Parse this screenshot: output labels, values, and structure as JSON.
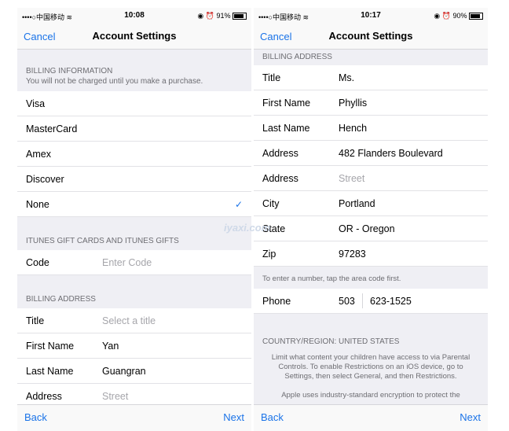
{
  "left": {
    "status": {
      "carrier": "••••○中国移动 ≋",
      "time": "10:08",
      "battery": "91%"
    },
    "nav": {
      "cancel": "Cancel",
      "title": "Account Settings"
    },
    "billing_info": {
      "header": "BILLING INFORMATION",
      "subheader": "You will not be charged until you make a purchase."
    },
    "payment_options": [
      "Visa",
      "MasterCard",
      "Amex",
      "Discover",
      "None"
    ],
    "gift": {
      "header": "ITUNES GIFT CARDS AND ITUNES GIFTS",
      "code_label": "Code",
      "code_placeholder": "Enter Code"
    },
    "billing_address": {
      "header": "BILLING ADDRESS",
      "title_label": "Title",
      "title_placeholder": "Select a title",
      "first_label": "First Name",
      "first_value": "Yan",
      "last_label": "Last Name",
      "last_value": "Guangran",
      "address_label": "Address",
      "address_placeholder": "Street"
    },
    "footer": {
      "back": "Back",
      "next": "Next"
    }
  },
  "right": {
    "status": {
      "carrier": "••••○中国移动 ≋",
      "time": "10:17",
      "battery": "90%"
    },
    "nav": {
      "cancel": "Cancel",
      "title": "Account Settings"
    },
    "billing_address": {
      "header": "BILLING ADDRESS",
      "title_label": "Title",
      "title_value": "Ms.",
      "first_label": "First Name",
      "first_value": "Phyllis",
      "last_label": "Last Name",
      "last_value": "Hench",
      "address_label": "Address",
      "address_value": "482 Flanders Boulevard",
      "address2_label": "Address",
      "address2_placeholder": "Street",
      "city_label": "City",
      "city_value": "Portland",
      "state_label": "State",
      "state_value": "OR - Oregon",
      "zip_label": "Zip",
      "zip_value": "97283"
    },
    "phone_note": "To enter a number, tap the area code first.",
    "phone": {
      "label": "Phone",
      "area": "503",
      "number": "623-1525"
    },
    "country": "COUNTRY/REGION: UNITED STATES",
    "restrictions": "Limit what content your children have access to via Parental Controls. To enable Restrictions on an iOS device, go to Settings, then select General, and then Restrictions.",
    "encryption": "Apple uses industry-standard encryption to protect the",
    "footer": {
      "back": "Back",
      "next": "Next"
    }
  },
  "watermark": "iyaxi.com",
  "accent_color": "#1a73e8"
}
